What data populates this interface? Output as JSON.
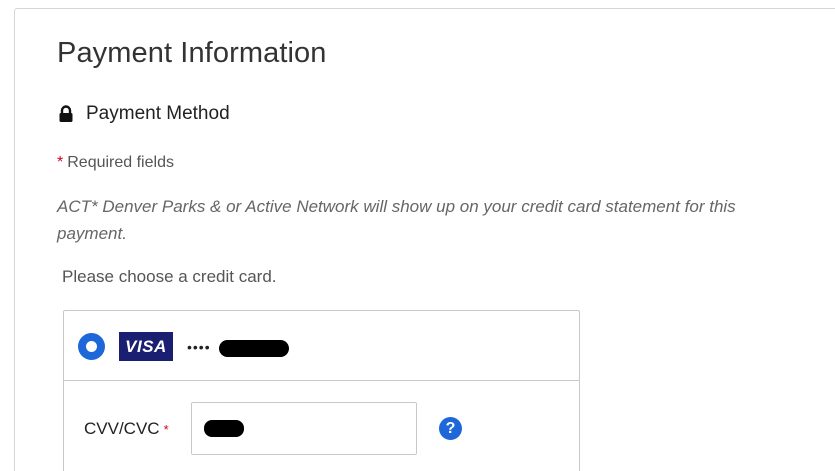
{
  "panel": {
    "title": "Payment Information",
    "method_label": "Payment Method",
    "required_star": "*",
    "required_text": "Required fields",
    "statement_text": "ACT* Denver Parks & or Active Network will show up on your credit card statement for this payment.",
    "choose_text": "Please choose a credit card."
  },
  "card": {
    "brand": "VISA",
    "masked_prefix": "••••",
    "selected": true
  },
  "cvv": {
    "label": "CVV/CVC",
    "star": "*"
  },
  "icons": {
    "lock": "lock-icon",
    "help": "question-help-icon"
  },
  "colors": {
    "accent": "#1d67d8",
    "visa": "#1a1f71",
    "required": "#d0021b"
  }
}
